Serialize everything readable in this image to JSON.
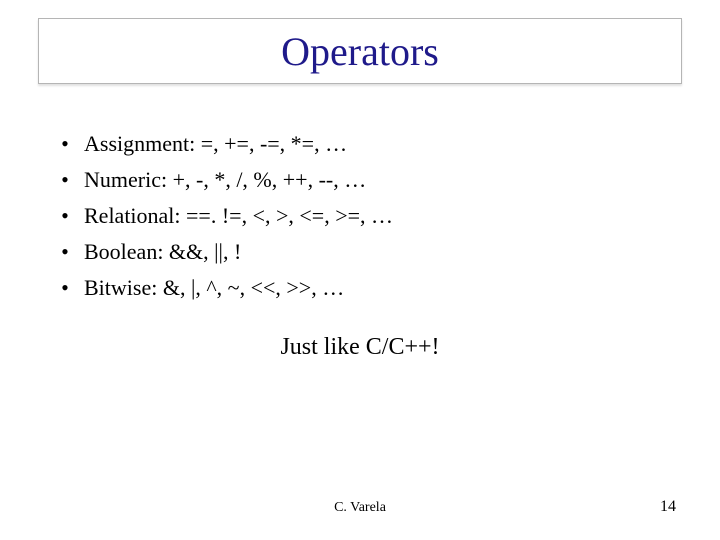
{
  "title": "Operators",
  "bullets": [
    "Assignment: =, +=, -=, *=, …",
    "Numeric: +, -, *, /, %, ++, --, …",
    "Relational: ==. !=, <, >, <=, >=, …",
    "Boolean: &&, ||, !",
    "Bitwise: &, |, ^, ~, <<, >>, …"
  ],
  "callout": "Just like C/C++!",
  "footer": {
    "author": "C. Varela",
    "page": "14"
  }
}
